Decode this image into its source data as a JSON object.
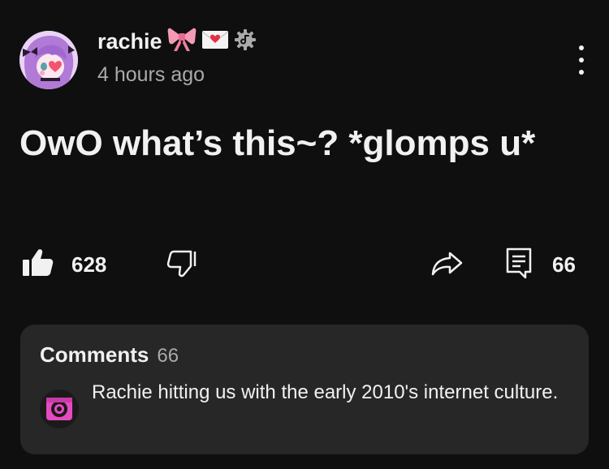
{
  "post": {
    "author": "rachie",
    "author_emojis": [
      "ribbon-emoji",
      "love-letter-emoji"
    ],
    "badge_icon": "verified-gear-icon",
    "timestamp": "4 hours ago",
    "text": "OwO what’s this~? *glomps u*",
    "likes": "628",
    "comments_count": "66"
  },
  "icons": {
    "like": "thumbs-up-filled-icon",
    "dislike": "thumbs-down-outline-icon",
    "share": "share-arrow-icon",
    "comment": "comment-icon",
    "menu": "more-vert-icon"
  },
  "comments": {
    "title": "Comments",
    "count": "66",
    "top_comment": "Rachie hitting us with the early 2010's internet culture."
  },
  "colors": {
    "background": "#0f0f0f",
    "card": "#272727",
    "text": "#f1f1f1",
    "muted": "#aaaaaa"
  }
}
